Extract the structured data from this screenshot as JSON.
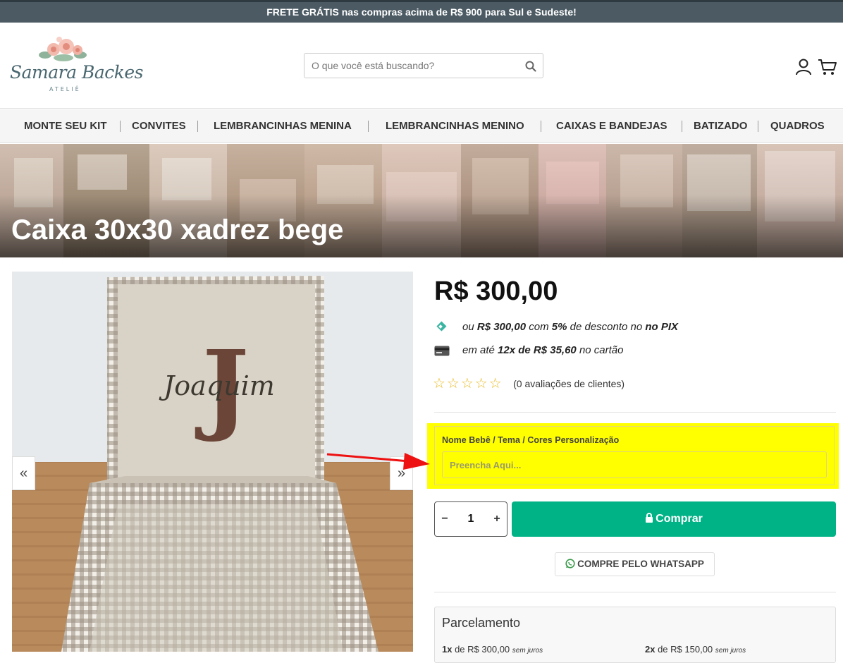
{
  "topbar": {
    "text": "FRETE GRÁTIS nas compras acima de R$ 900 para Sul e Sudeste!"
  },
  "header": {
    "logo_name": "Samara Backes",
    "logo_sub": "ATELIÊ",
    "search_placeholder": "O que você está buscando?",
    "icons": [
      "search-icon",
      "user-icon",
      "cart-icon"
    ]
  },
  "nav": {
    "items": [
      {
        "label": "MONTE SEU KIT"
      },
      {
        "label": "CONVITES"
      },
      {
        "label": "LEMBRANCINHAS MENINA"
      },
      {
        "label": "LEMBRANCINHAS MENINO"
      },
      {
        "label": "CAIXAS E BANDEJAS"
      },
      {
        "label": "BATIZADO"
      },
      {
        "label": "QUADROS"
      }
    ]
  },
  "banner": {
    "title": "Caixa 30x30 xadrez bege"
  },
  "gallery": {
    "prev_label": "«",
    "next_label": "»",
    "embroidery_name": "Joaquim",
    "embroidery_letter": "J"
  },
  "product": {
    "price": "R$ 300,00",
    "pix": {
      "prefix": "ou ",
      "amount": "R$ 300,00",
      "middle": " com ",
      "discount": "5%",
      "suffix": " de desconto no ",
      "method": "no PIX"
    },
    "card": {
      "prefix": "em até ",
      "installments": "12x de R$ 35,60",
      "suffix": " no cartão"
    },
    "rating": {
      "stars": "☆☆☆☆☆",
      "text": "(0 avaliações de clientes)",
      "score": 0,
      "max": 5
    },
    "custom_field": {
      "label": "Nome Bebê / Tema / Cores Personalização",
      "placeholder": "Preencha Aqui..."
    },
    "quantity": {
      "minus": "−",
      "value": "1",
      "plus": "+"
    },
    "buy_label": "Comprar",
    "whatsapp_label": "COMPRE PELO WHATSAPP",
    "colors": {
      "buy": "#00b386",
      "highlight": "#ffff00",
      "topbar": "#4b5a63"
    }
  },
  "installments": {
    "title": "Parcelamento",
    "items": [
      {
        "count": "1x",
        "de": " de ",
        "value": "R$ 300,00",
        "note": "sem juros"
      },
      {
        "count": "2x",
        "de": " de ",
        "value": "R$ 150,00",
        "note": "sem juros"
      }
    ]
  }
}
